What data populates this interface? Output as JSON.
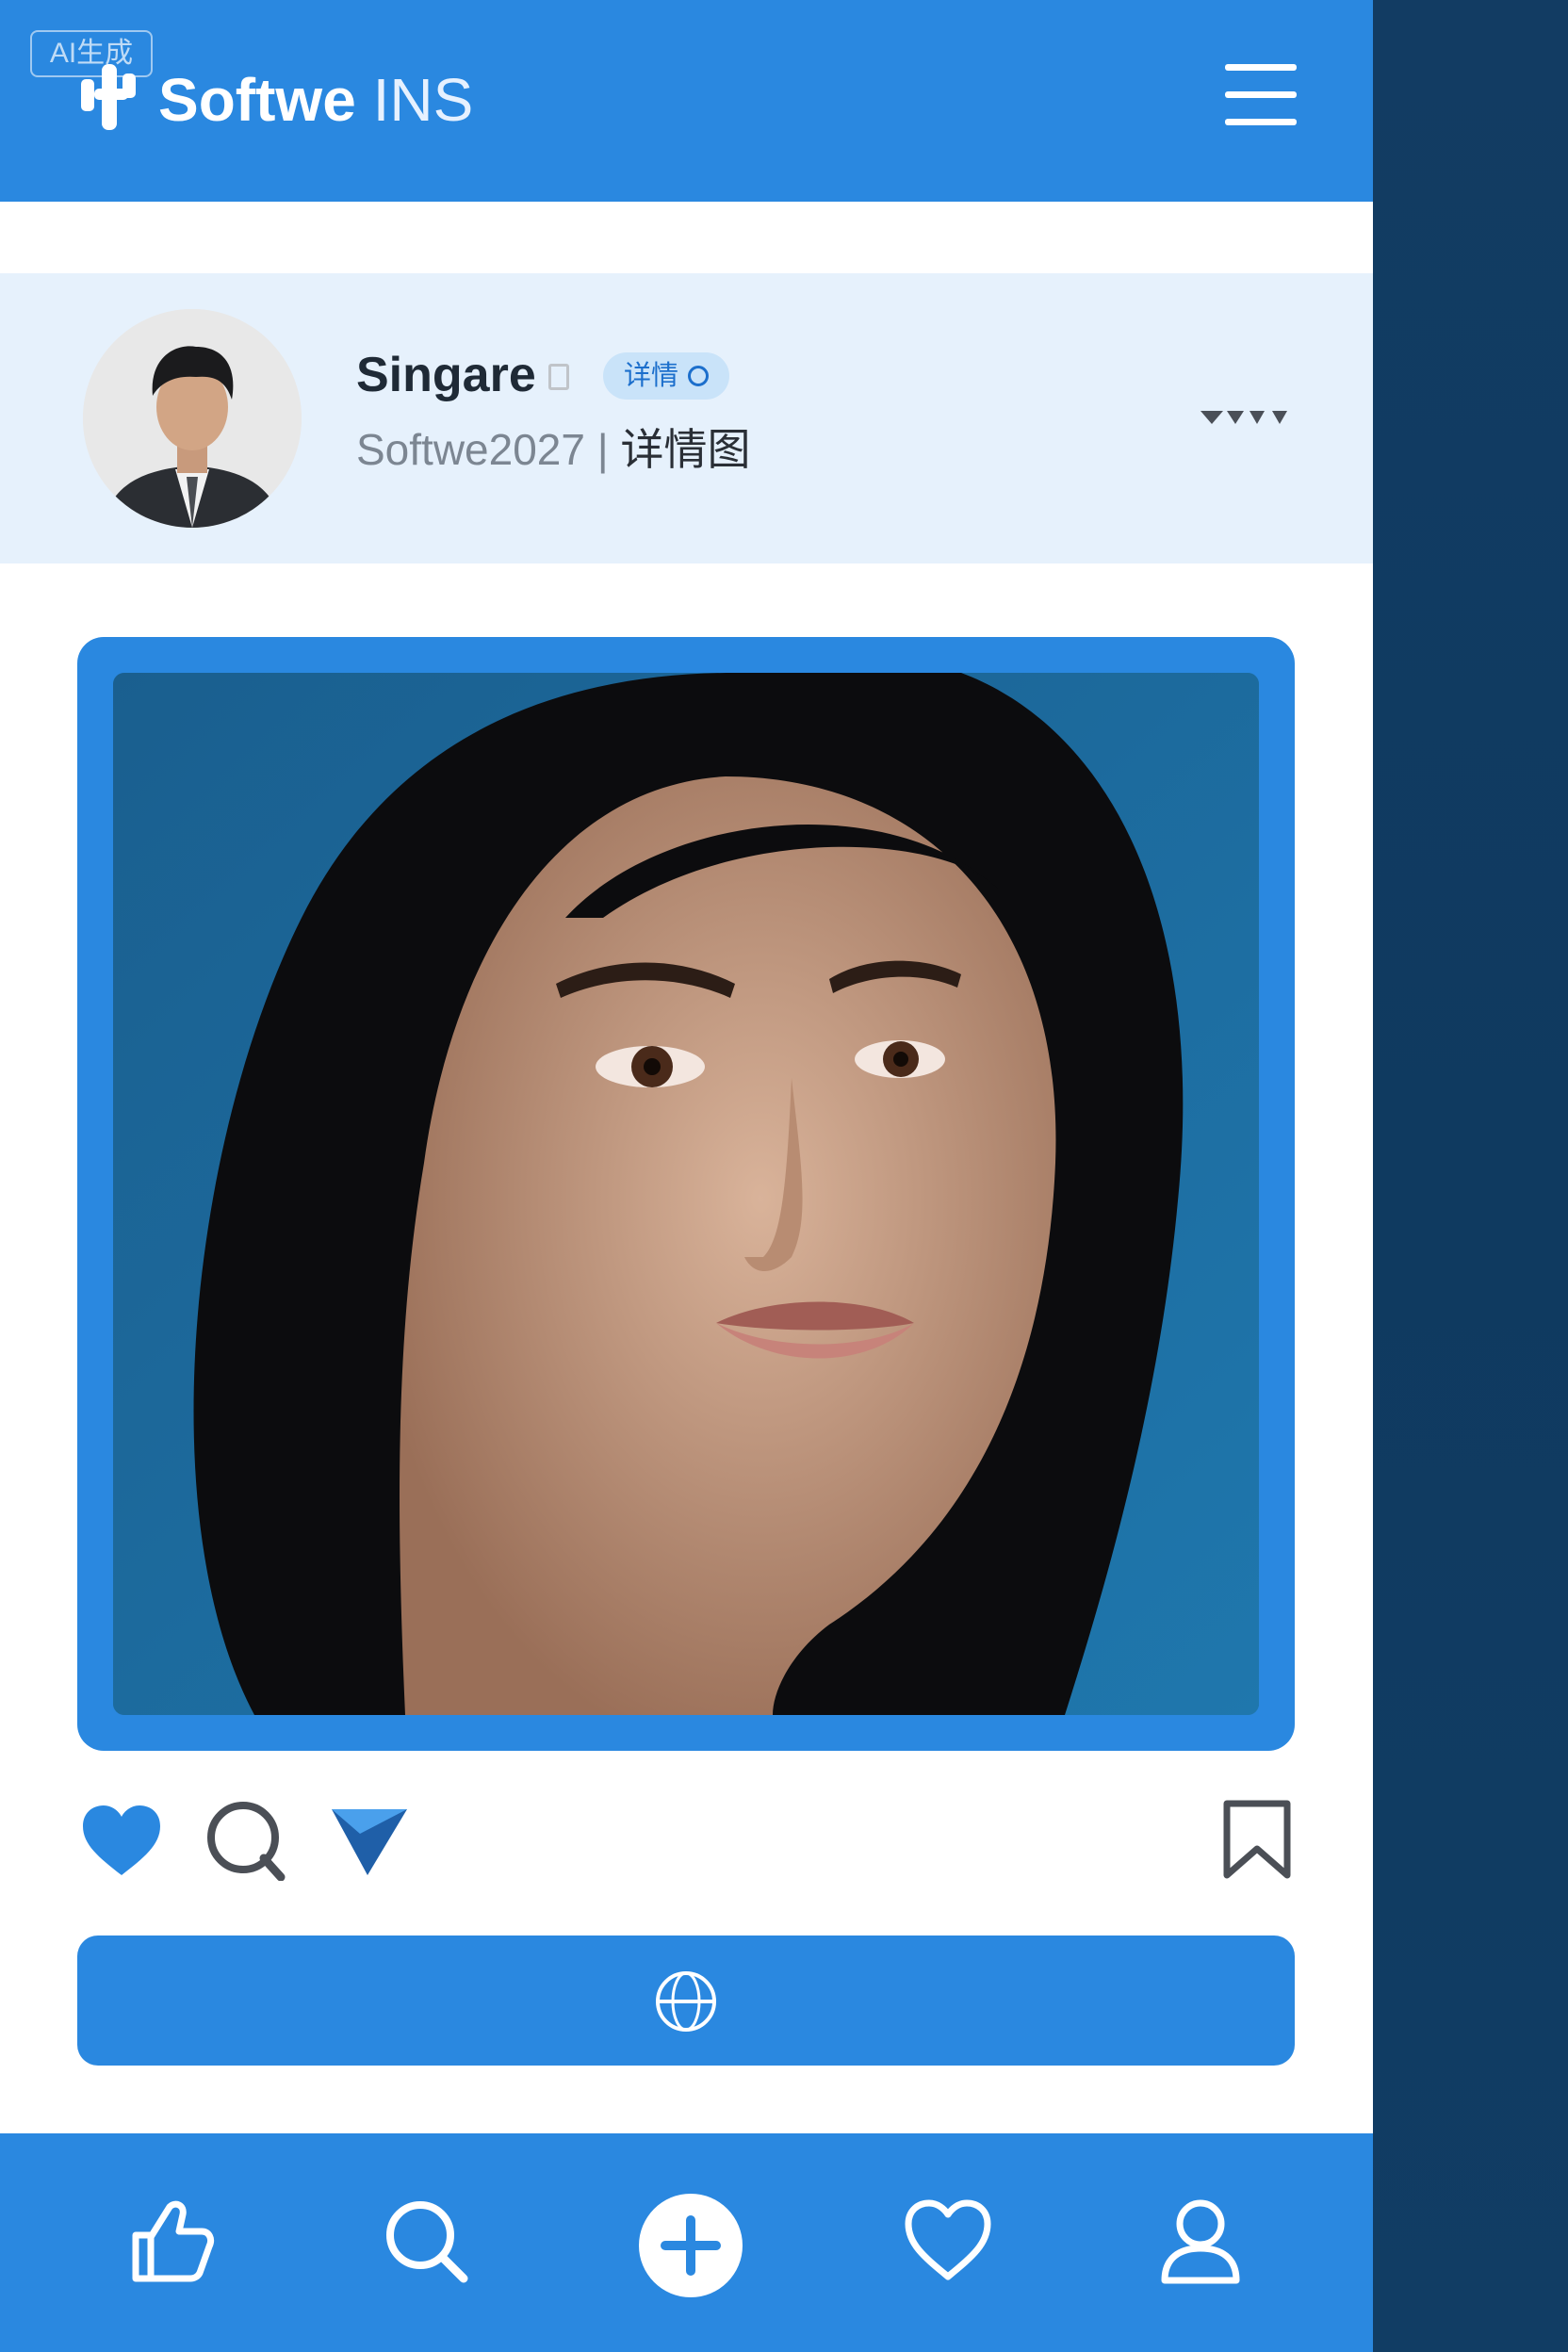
{
  "header": {
    "badge": "AI生成",
    "brand_bold": "Softwe",
    "brand_light": "INS",
    "menu_icon": "hamburger-menu-icon"
  },
  "profile": {
    "username": "Singare",
    "detail_pill": "详情",
    "subline_gray": "Softwe",
    "subline_num": "2027",
    "subline_sep": " | ",
    "subline_tail": "详情图",
    "more_icon": "more-dots-icon"
  },
  "post": {
    "image": "portrait-photo",
    "actions": [
      "heart-icon",
      "comment-icon",
      "send-icon",
      "bookmark-icon"
    ],
    "primary_button_icon": "globe-icon"
  },
  "bottom_nav": {
    "items": [
      "thumbs-up-icon",
      "search-icon",
      "add-icon",
      "heart-outline-icon",
      "profile-icon"
    ]
  },
  "colors": {
    "accent": "#2a88e0",
    "profile_bg": "#e6f1fc",
    "side_panel": "#123c63"
  }
}
